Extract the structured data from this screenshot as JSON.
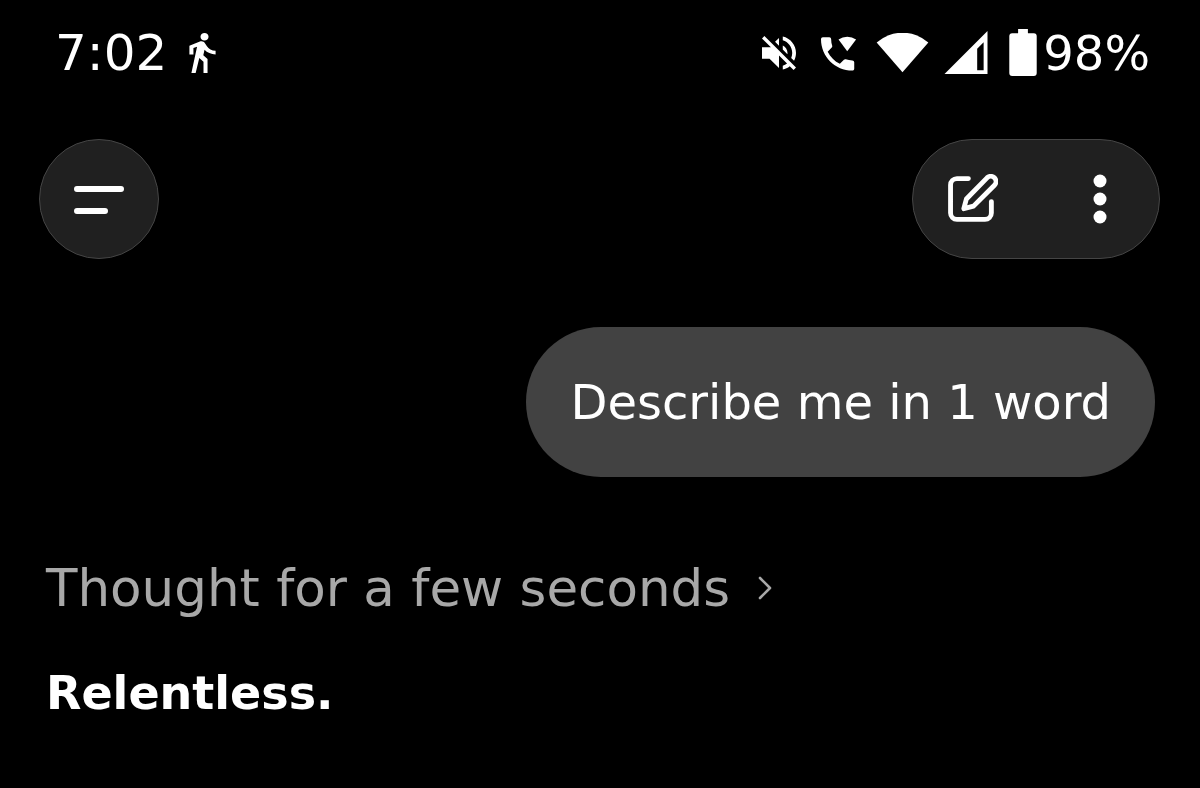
{
  "status_bar": {
    "time": "7:02",
    "battery_percent": "98%"
  },
  "messages": [
    {
      "kind": "user",
      "text": "Describe me in 1 word"
    },
    {
      "kind": "assistant",
      "thinking": "Thought for a few seconds",
      "text": "Relentless."
    }
  ]
}
